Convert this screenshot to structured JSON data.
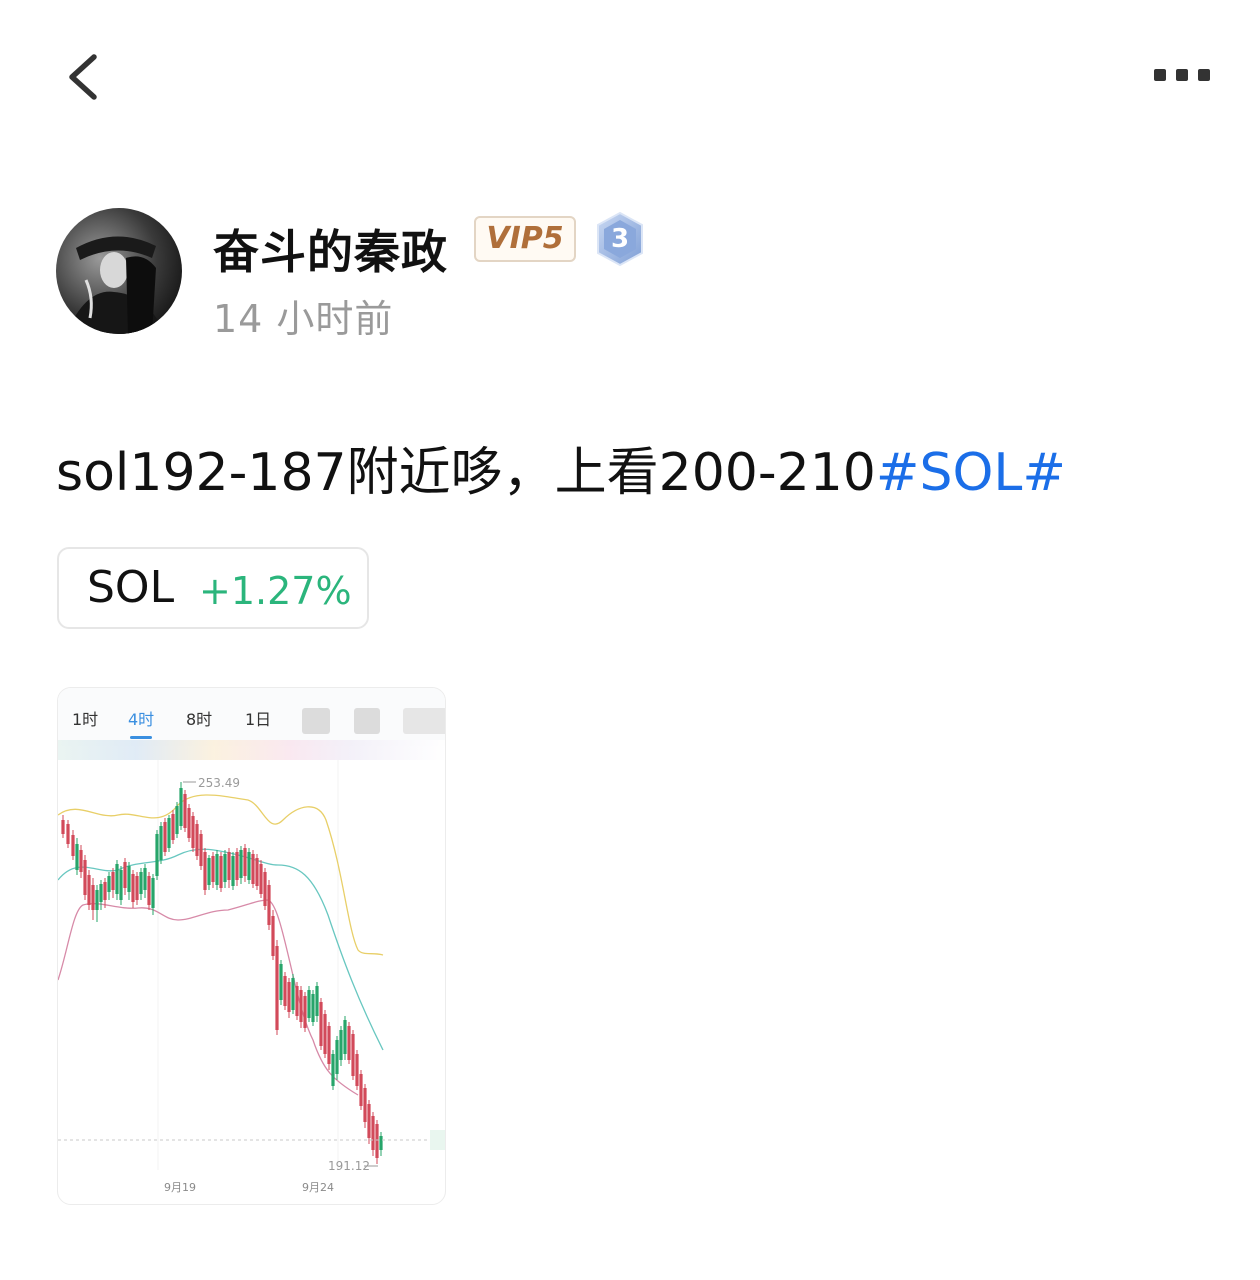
{
  "header": {
    "back_icon": "chevron-left-icon",
    "more_icon": "more-dots-icon"
  },
  "author": {
    "name": "奋斗的秦政",
    "vip_label": "VIP5",
    "level": "3",
    "time": "14 小时前"
  },
  "post": {
    "text": "sol192-187附近哆，上看200-210",
    "hashtag": "#SOL#"
  },
  "coin": {
    "symbol": "SOL",
    "change": "+1.27%",
    "change_color": "#2bb57c"
  },
  "chart": {
    "tabs": [
      "1时",
      "4时",
      "8时",
      "1日"
    ],
    "active_tab": "4时",
    "high_label": "253.49",
    "low_label": "191.12",
    "date_labels": [
      "9月19",
      "9月24"
    ],
    "up_color": "#27a56a",
    "down_color": "#d24a5a"
  },
  "chart_data": {
    "type": "candlestick",
    "high": 253.49,
    "low": 191.12,
    "x_ticks": [
      "9月19",
      "9月24"
    ],
    "bollinger_colors": {
      "upper": "#e8cf68",
      "middle": "#68c7c0",
      "lower": "#d78aa8"
    }
  }
}
